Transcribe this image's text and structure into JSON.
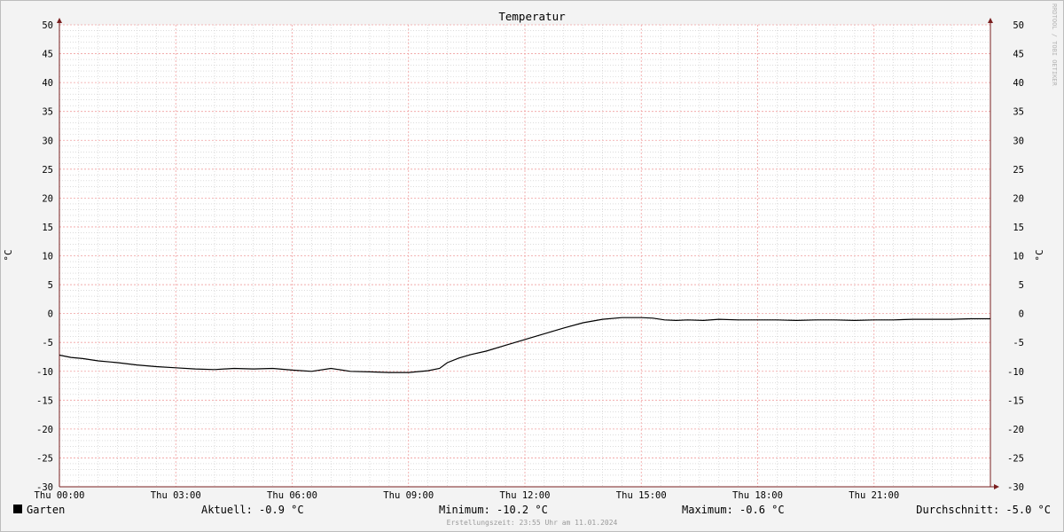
{
  "chart_data": {
    "type": "line",
    "title": "Temperatur",
    "ylabel": "°C",
    "ylim": [
      -30,
      50
    ],
    "y_ticks": [
      50,
      45,
      40,
      35,
      30,
      25,
      20,
      15,
      10,
      5,
      0,
      -5,
      -10,
      -15,
      -20,
      -25,
      -30
    ],
    "x_range_hours": [
      0,
      24
    ],
    "x_tick_labels": [
      "Thu 00:00",
      "Thu 03:00",
      "Thu 06:00",
      "Thu 09:00",
      "Thu 12:00",
      "Thu 15:00",
      "Thu 18:00",
      "Thu 21:00"
    ],
    "grid": true,
    "watermark": "RRDTOOL / TOBI OETIKER",
    "series": [
      {
        "name": "Garten",
        "color": "#000000",
        "x_hours": [
          0,
          0.3,
          0.6,
          1.0,
          1.5,
          2.0,
          2.5,
          3.0,
          3.5,
          4.0,
          4.5,
          5.0,
          5.5,
          6.0,
          6.5,
          7.0,
          7.5,
          8.0,
          8.5,
          9.0,
          9.5,
          9.8,
          10.0,
          10.3,
          10.6,
          11.0,
          11.5,
          12.0,
          12.5,
          13.0,
          13.5,
          14.0,
          14.5,
          15.0,
          15.3,
          15.6,
          15.9,
          16.2,
          16.6,
          17.0,
          17.5,
          18.0,
          18.5,
          19.0,
          19.5,
          20.0,
          20.5,
          21.0,
          21.5,
          22.0,
          22.5,
          23.0,
          23.5,
          24.0
        ],
        "values": [
          -7.2,
          -7.6,
          -7.8,
          -8.2,
          -8.5,
          -8.9,
          -9.2,
          -9.4,
          -9.6,
          -9.7,
          -9.5,
          -9.6,
          -9.5,
          -9.8,
          -10.0,
          -9.5,
          -10.0,
          -10.1,
          -10.2,
          -10.2,
          -9.9,
          -9.5,
          -8.5,
          -7.7,
          -7.1,
          -6.5,
          -5.5,
          -4.5,
          -3.5,
          -2.5,
          -1.6,
          -1.0,
          -0.7,
          -0.7,
          -0.8,
          -1.1,
          -1.2,
          -1.1,
          -1.2,
          -1.0,
          -1.1,
          -1.1,
          -1.1,
          -1.2,
          -1.1,
          -1.1,
          -1.2,
          -1.1,
          -1.1,
          -1.0,
          -1.0,
          -1.0,
          -0.9,
          -0.9
        ]
      }
    ]
  },
  "legend": {
    "series_label": "Garten",
    "aktuell": "Aktuell: -0.9 °C",
    "minimum": "Minimum: -10.2 °C",
    "maximum": "Maximum: -0.6 °C",
    "durchschnitt": "Durchschnitt: -5.0 °C"
  },
  "footer": "Erstellungszeit: 23:55 Uhr am 11.01.2024",
  "colors": {
    "background": "#f3f3f3",
    "plot_background": "#ffffff",
    "major_grid": "#f0a0a0",
    "minor_grid": "#c8c8c8",
    "axis": "#7a1f1f",
    "line": "#000000"
  }
}
